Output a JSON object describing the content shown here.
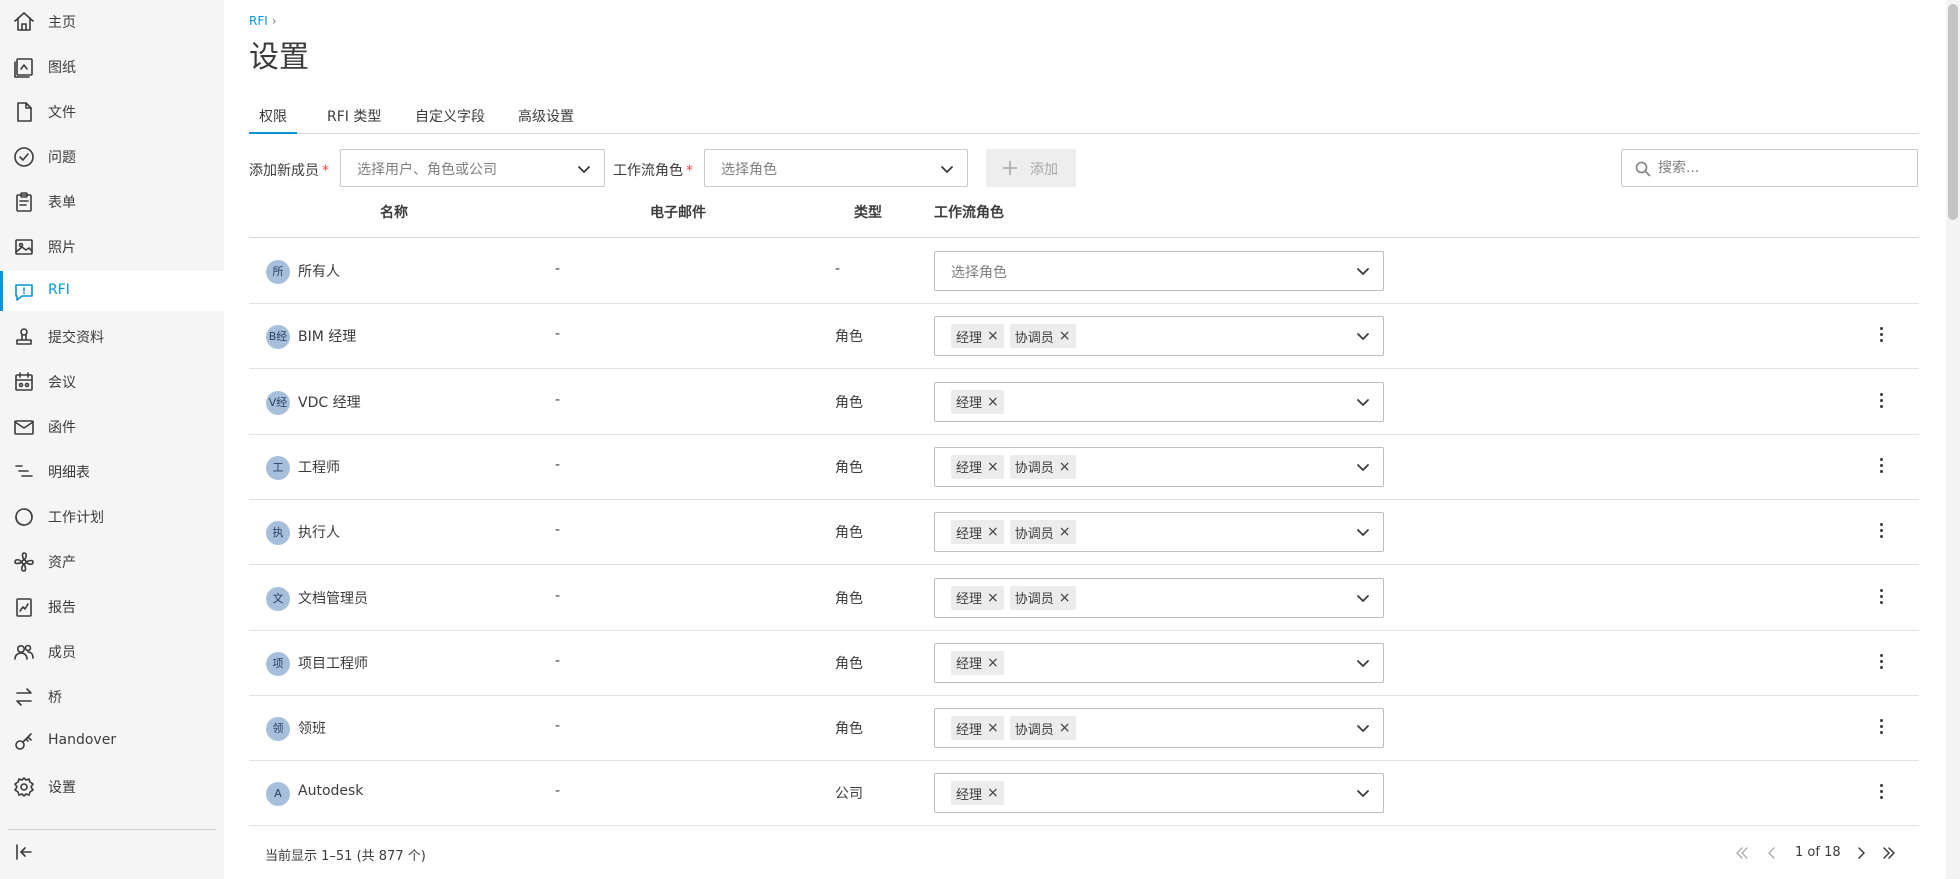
{
  "sidebar": {
    "items": [
      {
        "label": "主页",
        "icon": "home-icon"
      },
      {
        "label": "图纸",
        "icon": "sheets-icon"
      },
      {
        "label": "文件",
        "icon": "file-icon"
      },
      {
        "label": "问题",
        "icon": "issues-icon"
      },
      {
        "label": "表单",
        "icon": "forms-icon"
      },
      {
        "label": "照片",
        "icon": "photos-icon"
      },
      {
        "label": "RFI",
        "icon": "rfi-icon",
        "active": true
      },
      {
        "label": "提交资料",
        "icon": "submittals-icon"
      },
      {
        "label": "会议",
        "icon": "meetings-icon"
      },
      {
        "label": "函件",
        "icon": "correspondence-icon"
      },
      {
        "label": "明细表",
        "icon": "schedule-icon"
      },
      {
        "label": "工作计划",
        "icon": "work-plan-icon"
      },
      {
        "label": "资产",
        "icon": "assets-icon"
      },
      {
        "label": "报告",
        "icon": "reports-icon"
      },
      {
        "label": "成员",
        "icon": "members-icon"
      },
      {
        "label": "桥",
        "icon": "bridge-icon"
      },
      {
        "label": "Handover",
        "icon": "handover-icon"
      },
      {
        "label": "设置",
        "icon": "settings-icon"
      }
    ],
    "accent_color": "#0696d7"
  },
  "breadcrumb": {
    "parent": "RFI",
    "separator": "›"
  },
  "page": {
    "title": "设置"
  },
  "tabs": [
    {
      "label": "权限",
      "active": true
    },
    {
      "label": "RFI 类型"
    },
    {
      "label": "自定义字段"
    },
    {
      "label": "高级设置"
    }
  ],
  "add_member": {
    "label": "添加新成员",
    "required_mark": "*",
    "placeholder": "选择用户、角色或公司",
    "role_label": "工作流角色",
    "role_placeholder": "选择角色",
    "add_button": "添加"
  },
  "search": {
    "placeholder": "搜索..."
  },
  "table": {
    "headers": {
      "name": "名称",
      "email": "电子邮件",
      "type": "类型",
      "role": "工作流角色"
    },
    "role_placeholder": "选择角色",
    "rows": [
      {
        "avatar": "所",
        "name": "所有人",
        "email": "-",
        "type": "-",
        "roles": []
      },
      {
        "avatar": "B经",
        "name": "BIM 经理",
        "email": "-",
        "type": "角色",
        "roles": [
          "经理",
          "协调员"
        ]
      },
      {
        "avatar": "V经",
        "name": "VDC 经理",
        "email": "-",
        "type": "角色",
        "roles": [
          "经理"
        ]
      },
      {
        "avatar": "工",
        "name": "工程师",
        "email": "-",
        "type": "角色",
        "roles": [
          "经理",
          "协调员"
        ]
      },
      {
        "avatar": "执",
        "name": "执行人",
        "email": "-",
        "type": "角色",
        "roles": [
          "经理",
          "协调员"
        ]
      },
      {
        "avatar": "文",
        "name": "文档管理员",
        "email": "-",
        "type": "角色",
        "roles": [
          "经理",
          "协调员"
        ]
      },
      {
        "avatar": "项",
        "name": "项目工程师",
        "email": "-",
        "type": "角色",
        "roles": [
          "经理"
        ]
      },
      {
        "avatar": "领",
        "name": "领班",
        "email": "-",
        "type": "角色",
        "roles": [
          "经理",
          "协调员"
        ]
      },
      {
        "avatar": "A",
        "name": "Autodesk",
        "email": "-",
        "type": "公司",
        "roles": [
          "经理"
        ]
      }
    ]
  },
  "footer": {
    "range_text": "当前显示 1–51 (共 877 个)",
    "page_indicator": "1 of 18"
  }
}
